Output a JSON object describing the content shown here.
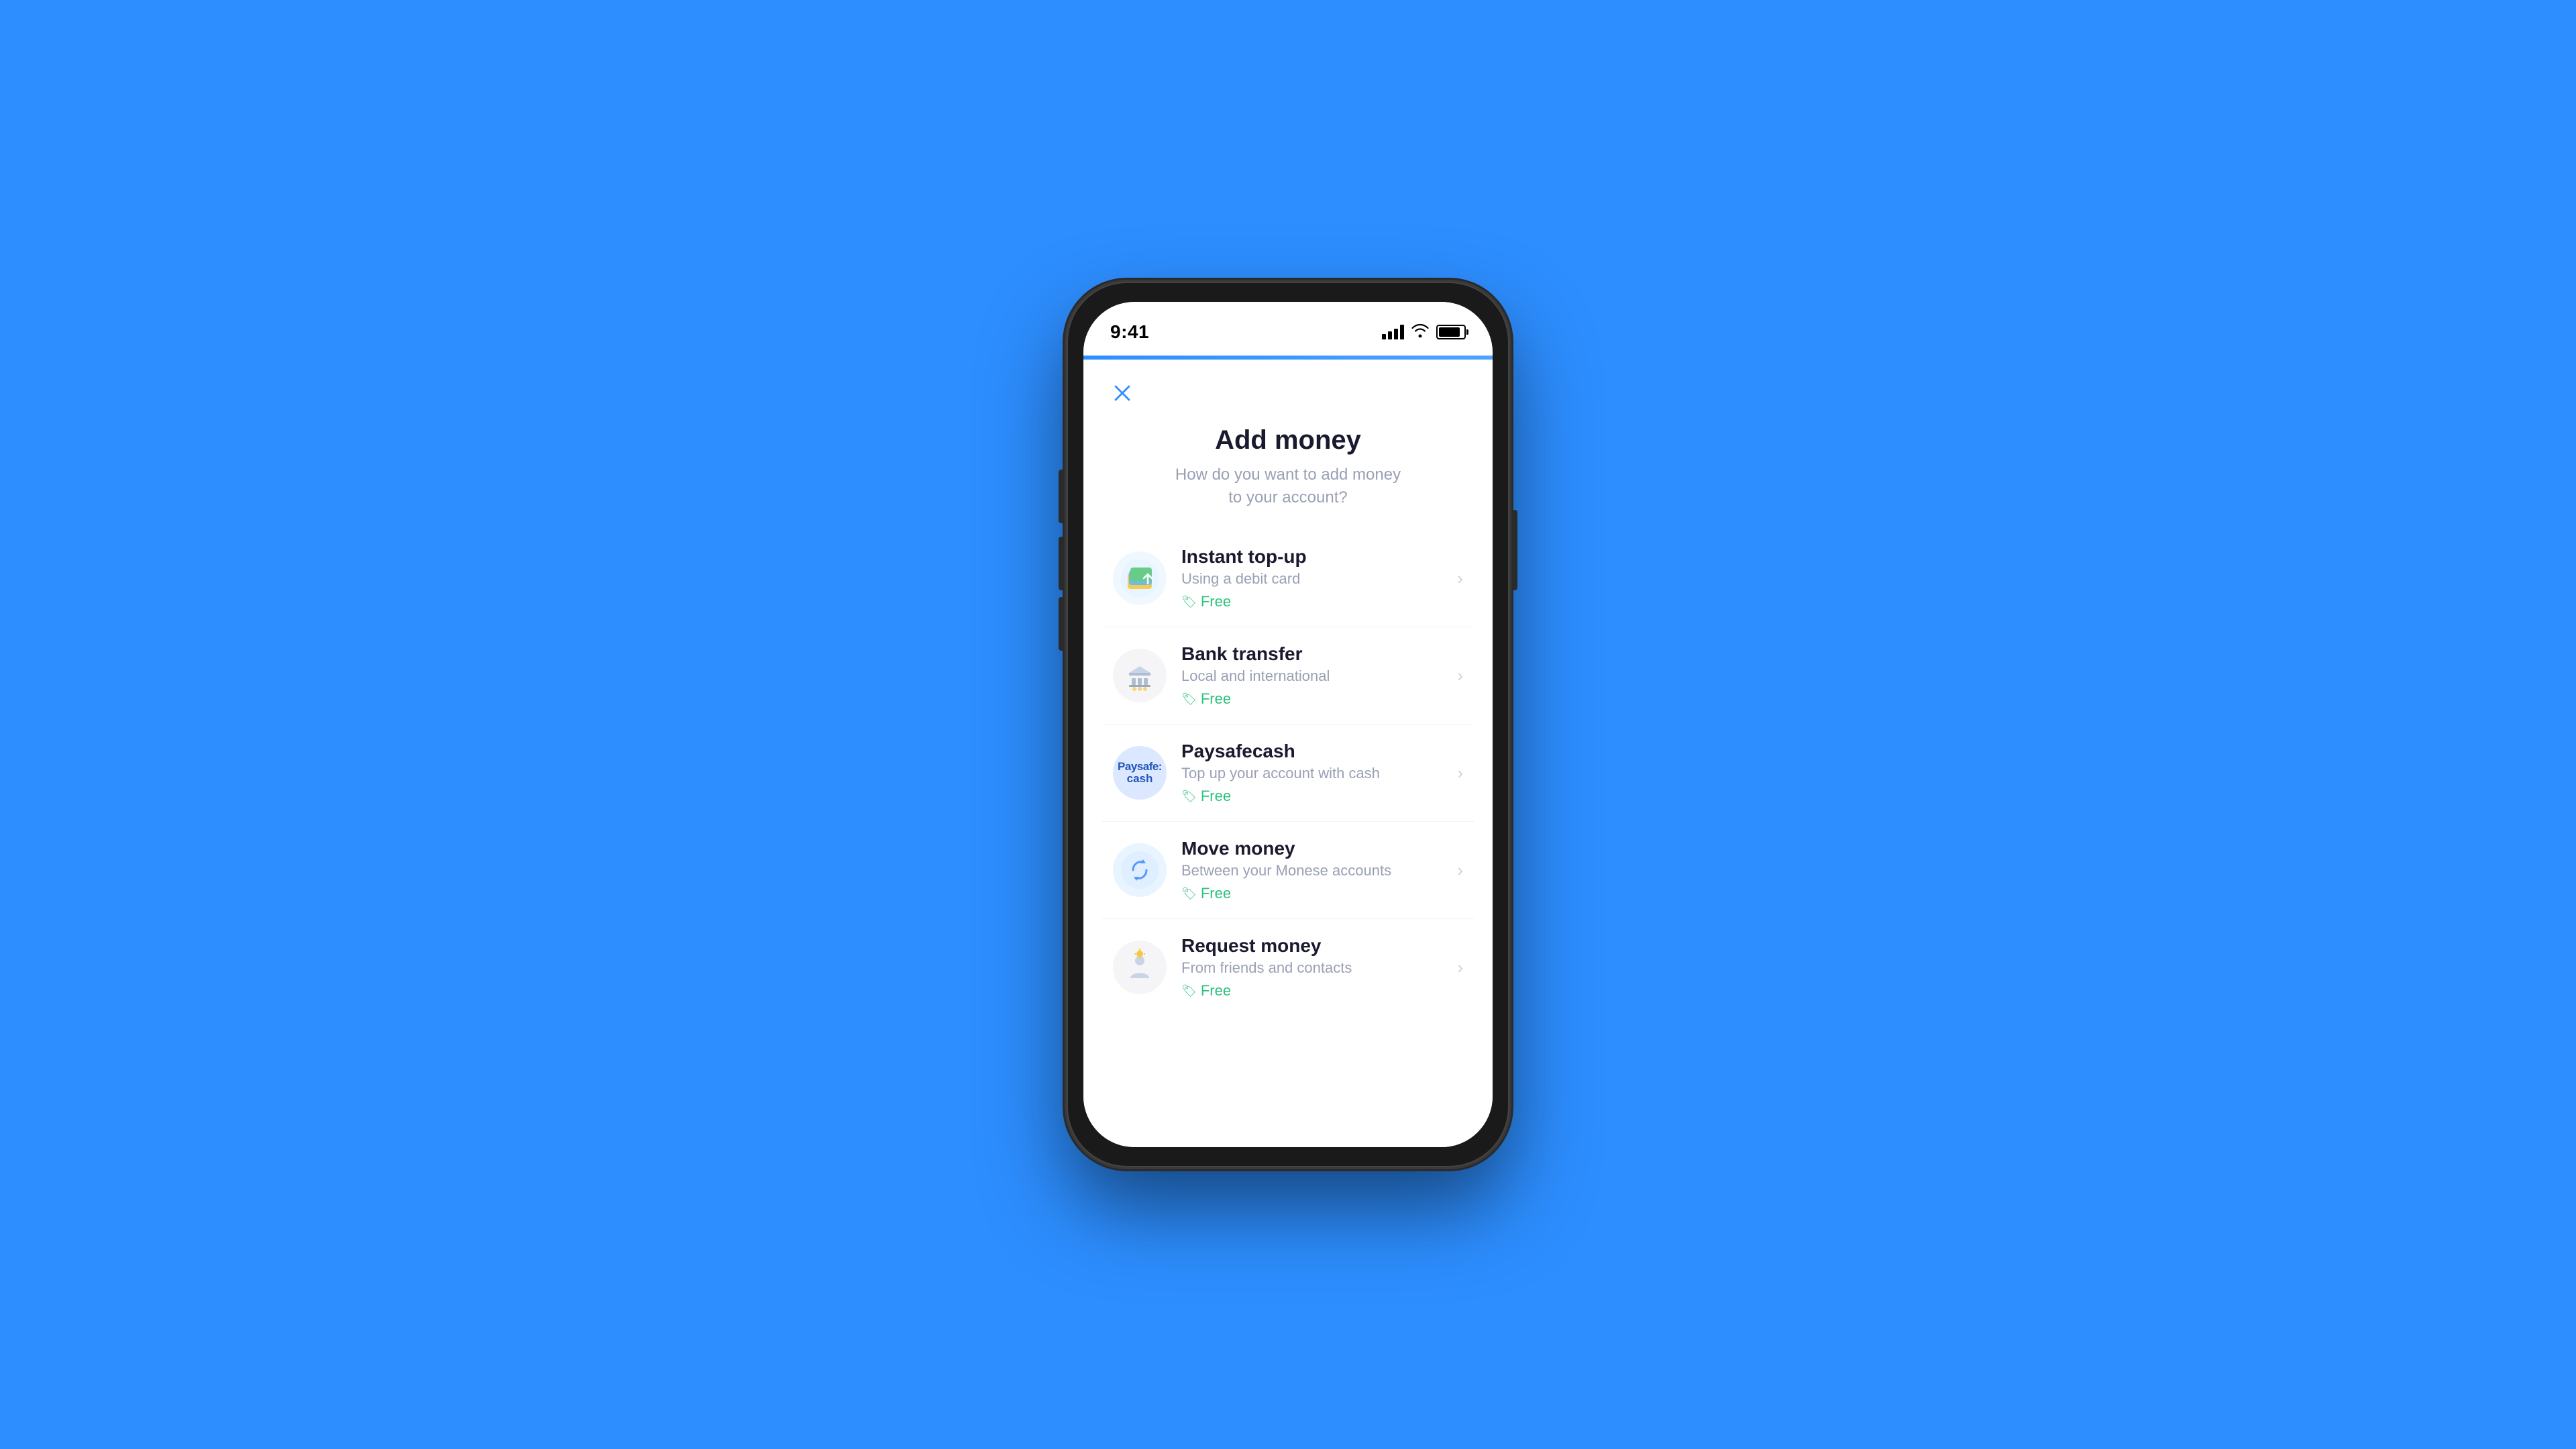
{
  "status_bar": {
    "time": "9:41",
    "battery_level": "85"
  },
  "top_accent": true,
  "page": {
    "title": "Add money",
    "subtitle": "How do you want to add money\nto your account?"
  },
  "close_button": "×",
  "options": [
    {
      "id": "instant-topup",
      "title": "Instant top-up",
      "description": "Using a debit card",
      "badge": "Free",
      "icon_type": "instant"
    },
    {
      "id": "bank-transfer",
      "title": "Bank transfer",
      "description": "Local and international",
      "badge": "Free",
      "icon_type": "bank"
    },
    {
      "id": "paysafecash",
      "title": "Paysafecash",
      "description": "Top up your account with cash",
      "badge": "Free",
      "icon_type": "paysafe"
    },
    {
      "id": "move-money",
      "title": "Move money",
      "description": "Between your Monese accounts",
      "badge": "Free",
      "icon_type": "move"
    },
    {
      "id": "request-money",
      "title": "Request money",
      "description": "From friends and contacts",
      "badge": "Free",
      "icon_type": "request"
    }
  ]
}
